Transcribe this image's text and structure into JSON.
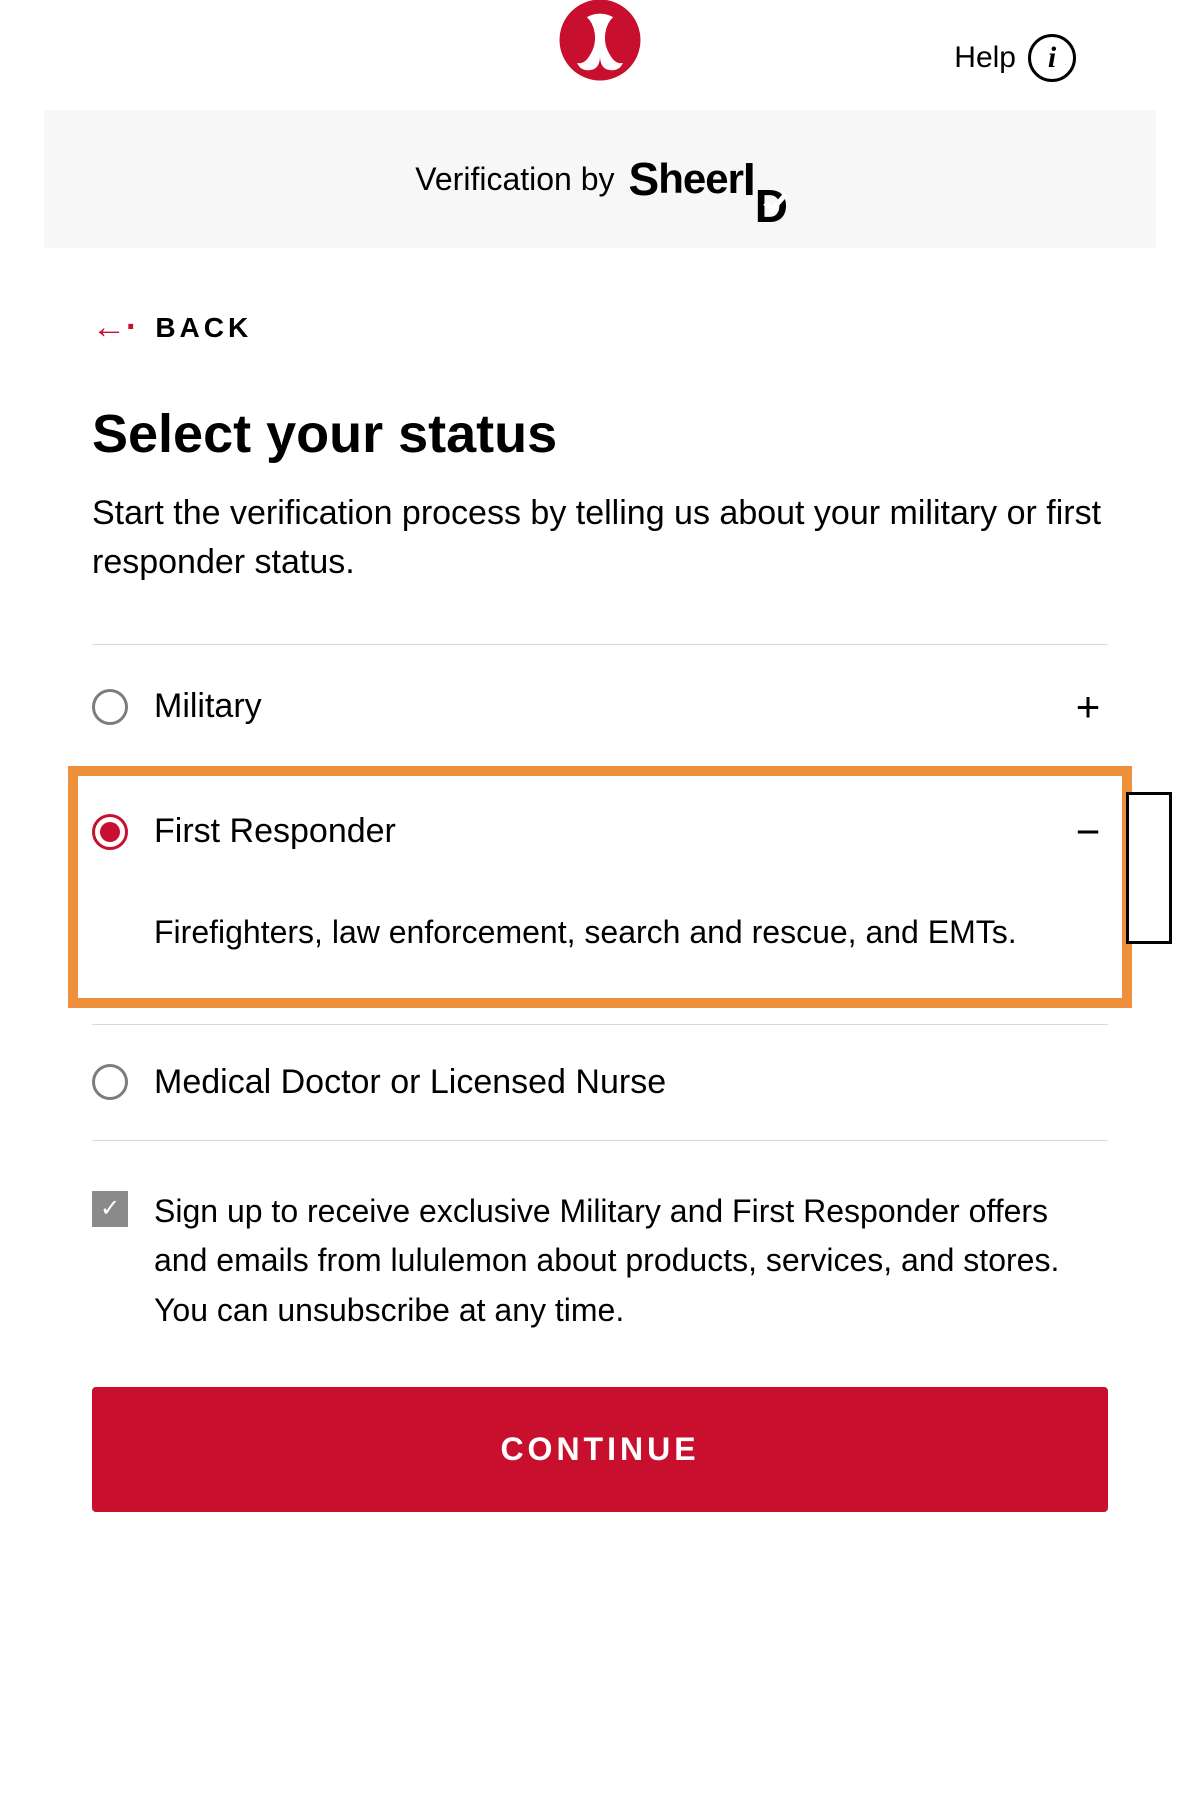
{
  "header": {
    "help_label": "Help"
  },
  "verification_strip": {
    "prefix": "Verification by",
    "brand": "SheerID"
  },
  "nav": {
    "back_label": "BACK"
  },
  "heading": {
    "title": "Select your status",
    "subtitle": "Start the verification process by telling us about your military or first responder status."
  },
  "options": [
    {
      "label": "Military",
      "selected": false,
      "expanded": false
    },
    {
      "label": "First Responder",
      "selected": true,
      "expanded": true,
      "description": "Firefighters, law enforcement, search and rescue, and EMTs."
    },
    {
      "label": "Medical Doctor or Licensed Nurse",
      "selected": false,
      "expanded": false
    }
  ],
  "consent": {
    "checked": true,
    "text": "Sign up to receive exclusive Military and First Responder offers and emails from lululemon about products, services, and stores. You can unsubscribe at any time."
  },
  "actions": {
    "continue_label": "CONTINUE"
  },
  "icons": {
    "plus": "+",
    "minus": "−",
    "check": "✓",
    "back_arrow": "←·"
  },
  "colors": {
    "brand_red": "#c8102e",
    "highlight_orange": "#ee8f3c"
  }
}
